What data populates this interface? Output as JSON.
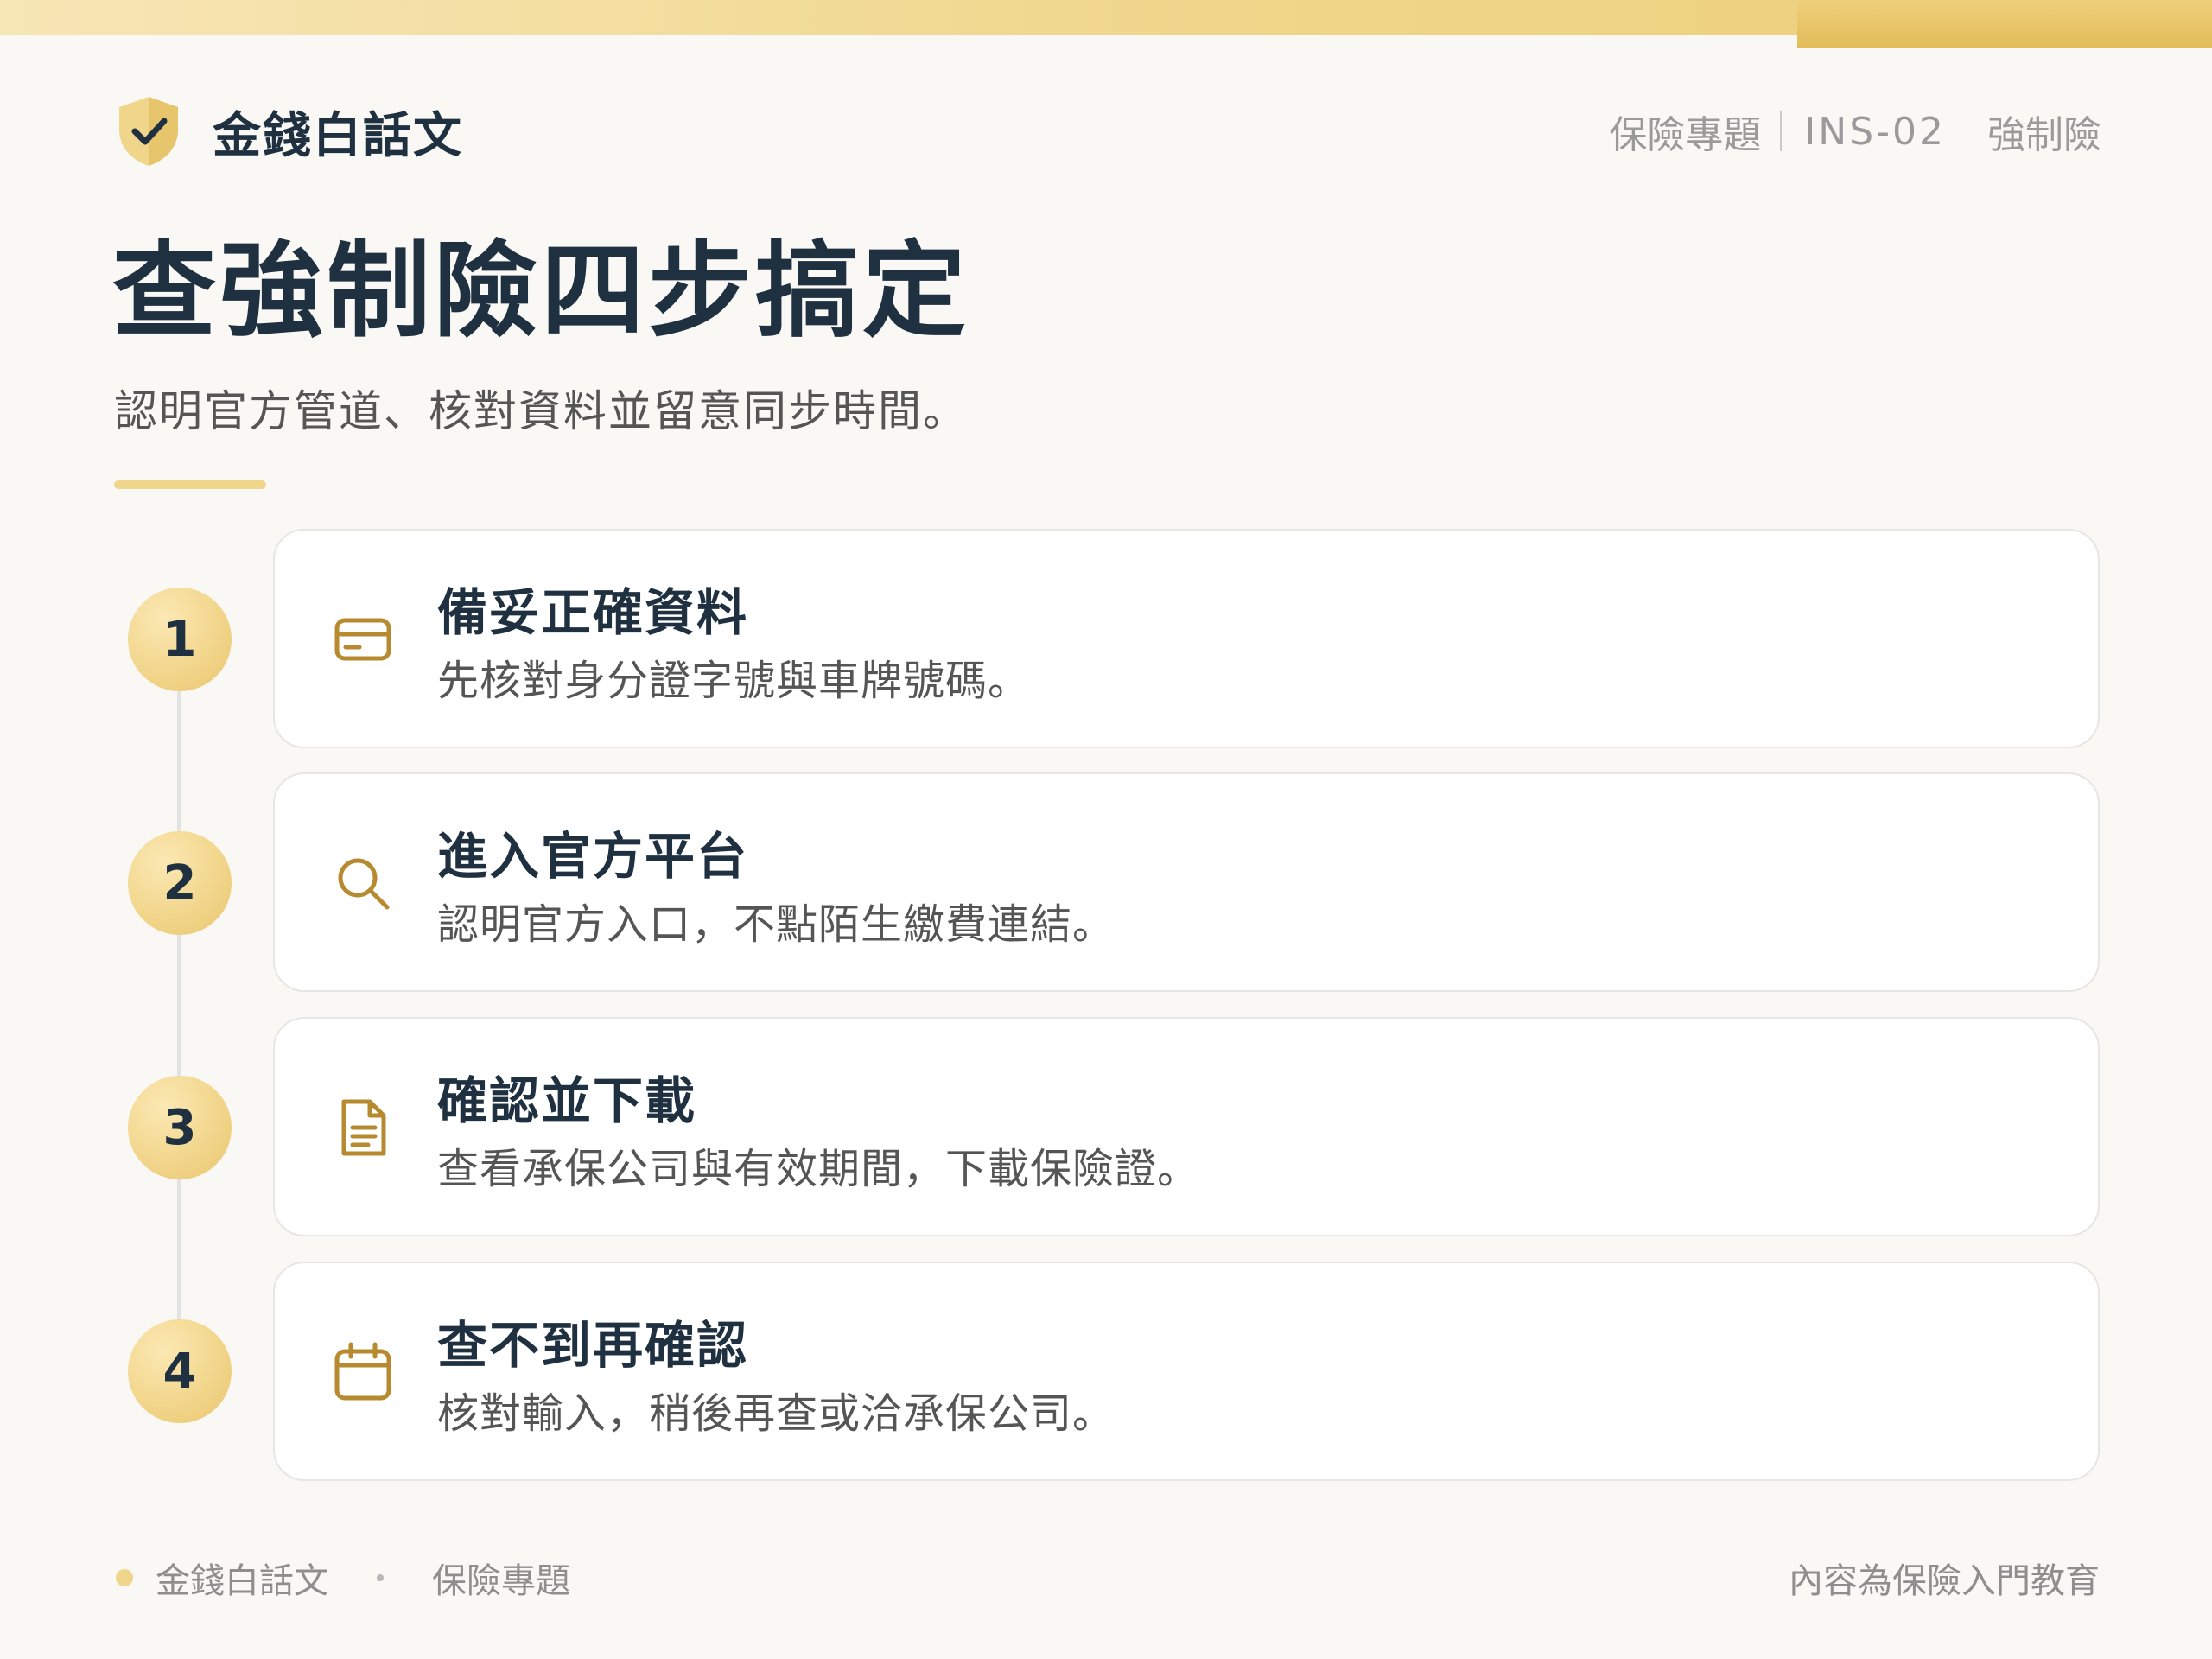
{
  "colors": {
    "accent_gold": "#f0d68a",
    "icon_gold": "#b78a30",
    "navy": "#1f3040",
    "background": "#f9f8f5"
  },
  "brand": {
    "icon": "shield-check-icon",
    "name": "金錢白話文"
  },
  "header_meta": {
    "category": "保險專題",
    "code": "INS-02",
    "tag": "強制險"
  },
  "page": {
    "title": "查強制險四步搞定",
    "subtitle": "認明官方管道、核對資料並留意同步時間。"
  },
  "steps": [
    {
      "number": "1",
      "icon": "card-icon",
      "title": "備妥正確資料",
      "desc": "先核對身分證字號與車牌號碼。"
    },
    {
      "number": "2",
      "icon": "search-icon",
      "title": "進入官方平台",
      "desc": "認明官方入口，不點陌生繳費連結。"
    },
    {
      "number": "3",
      "icon": "document-icon",
      "title": "確認並下載",
      "desc": "查看承保公司與有效期間，下載保險證。"
    },
    {
      "number": "4",
      "icon": "calendar-icon",
      "title": "查不到再確認",
      "desc": "核對輸入，稍後再查或洽承保公司。"
    }
  ],
  "footer": {
    "brand": "金錢白話文",
    "category": "保險專題",
    "note": "內容為保險入門教育"
  }
}
